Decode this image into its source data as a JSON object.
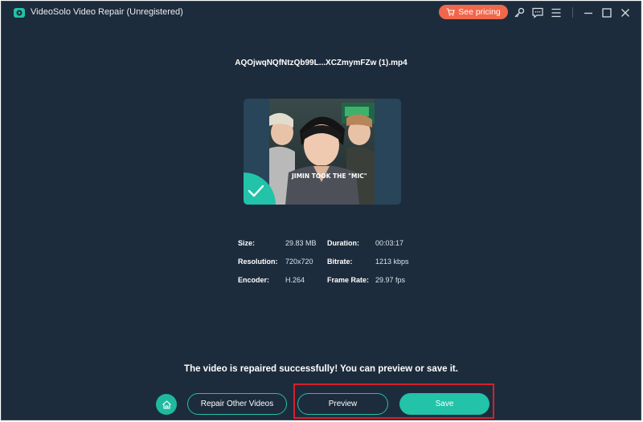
{
  "window": {
    "title": "VideoSolo Video Repair (Unregistered)",
    "pricing_label": "See pricing",
    "accent_color": "#22c3a8",
    "pricing_color": "#f0674c"
  },
  "titlebar_icons": [
    "key-icon",
    "feedback-icon",
    "menu-icon",
    "minimize-icon",
    "maximize-icon",
    "close-icon"
  ],
  "video": {
    "file_name": "AQOjwqNQfNtzQb99L...XCZmymFZw (1).mp4",
    "thumbnail_caption": "JIMIN TOOK THE \"MIC\"",
    "repaired": true
  },
  "info": {
    "size_label": "Size:",
    "size_value": "29.83 MB",
    "duration_label": "Duration:",
    "duration_value": "00:03:17",
    "resolution_label": "Resolution:",
    "resolution_value": "720x720",
    "bitrate_label": "Bitrate:",
    "bitrate_value": "1213 kbps",
    "encoder_label": "Encoder:",
    "encoder_value": "H.264",
    "framerate_label": "Frame Rate:",
    "framerate_value": "29.97 fps"
  },
  "status_message": "The video is repaired successfully! You can preview or save it.",
  "actions": {
    "repair_other_label": "Repair Other Videos",
    "preview_label": "Preview",
    "save_label": "Save"
  }
}
